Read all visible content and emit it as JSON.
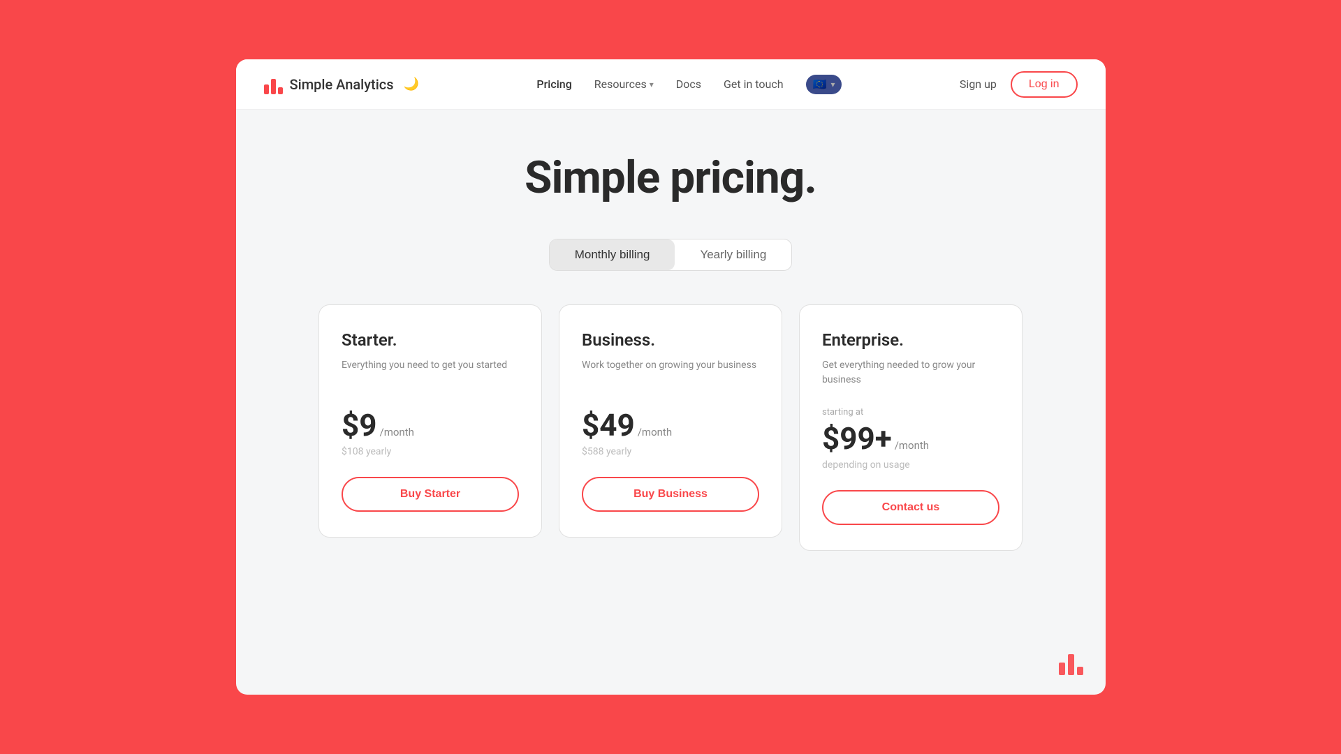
{
  "brand": {
    "name": "Simple Analytics",
    "logo_alt": "Simple Analytics logo"
  },
  "navbar": {
    "links": [
      {
        "label": "Pricing",
        "has_dropdown": false,
        "active": true
      },
      {
        "label": "Resources",
        "has_dropdown": true,
        "active": false
      },
      {
        "label": "Docs",
        "has_dropdown": false,
        "active": false
      },
      {
        "label": "Get in touch",
        "has_dropdown": false,
        "active": false
      }
    ],
    "region_label": "EU",
    "sign_up_label": "Sign up",
    "log_in_label": "Log in"
  },
  "hero": {
    "title": "Simple pricing."
  },
  "billing_toggle": {
    "monthly_label": "Monthly billing",
    "yearly_label": "Yearly billing",
    "active": "monthly"
  },
  "plans": [
    {
      "name": "Starter.",
      "description": "Everything you need to get you started",
      "starting_at": "",
      "price": "$9",
      "per_month": "/month",
      "yearly_price": "$108 yearly",
      "cta_label": "Buy Starter",
      "plus": false
    },
    {
      "name": "Business.",
      "description": "Work together on growing your business",
      "starting_at": "",
      "price": "$49",
      "per_month": "/month",
      "yearly_price": "$588 yearly",
      "cta_label": "Buy Business",
      "plus": false
    },
    {
      "name": "Enterprise.",
      "description": "Get everything needed to grow your business",
      "starting_at": "starting at",
      "price": "$99+",
      "per_month": "/month",
      "yearly_price": "depending on usage",
      "cta_label": "Contact us",
      "plus": true
    }
  ]
}
